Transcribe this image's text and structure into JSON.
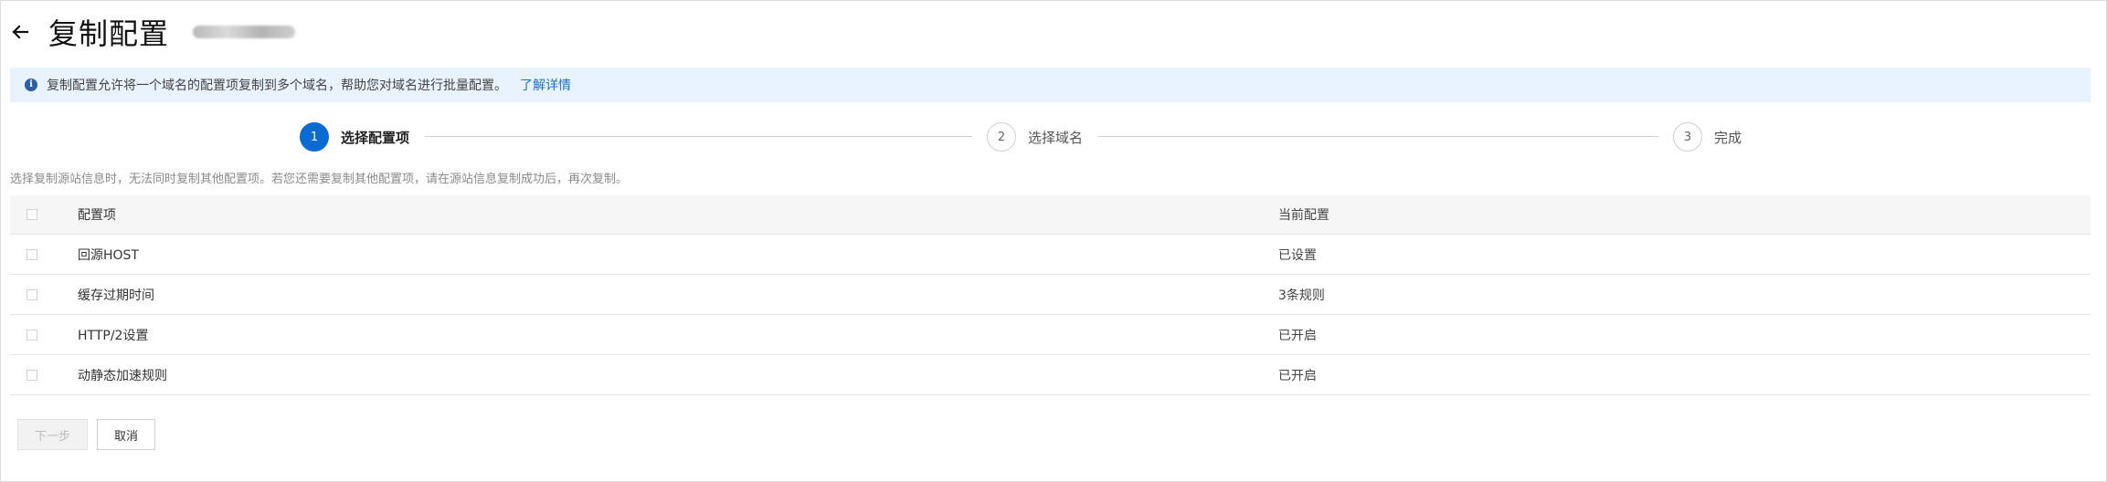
{
  "header": {
    "title": "复制配置"
  },
  "banner": {
    "text": "复制配置允许将一个域名的配置项复制到多个域名，帮助您对域名进行批量配置。",
    "link": "了解详情"
  },
  "steps": [
    {
      "number": "1",
      "label": "选择配置项"
    },
    {
      "number": "2",
      "label": "选择域名"
    },
    {
      "number": "3",
      "label": "完成"
    }
  ],
  "hint": "选择复制源站信息时，无法同时复制其他配置项。若您还需要复制其他配置项，请在源站信息复制成功后，再次复制。",
  "table": {
    "headers": {
      "name": "配置项",
      "value": "当前配置"
    },
    "rows": [
      {
        "name": "回源HOST",
        "value": "已设置"
      },
      {
        "name": "缓存过期时间",
        "value": "3条规则"
      },
      {
        "name": "HTTP/2设置",
        "value": "已开启"
      },
      {
        "name": "动静态加速规则",
        "value": "已开启"
      }
    ]
  },
  "footer": {
    "next": "下一步",
    "cancel": "取消"
  },
  "icons": {
    "back": "arrow-left-icon",
    "info": "info-icon"
  },
  "colors": {
    "accent": "#0b6bd0",
    "banner_bg": "#e8f3ff",
    "link": "#1a70c6"
  }
}
